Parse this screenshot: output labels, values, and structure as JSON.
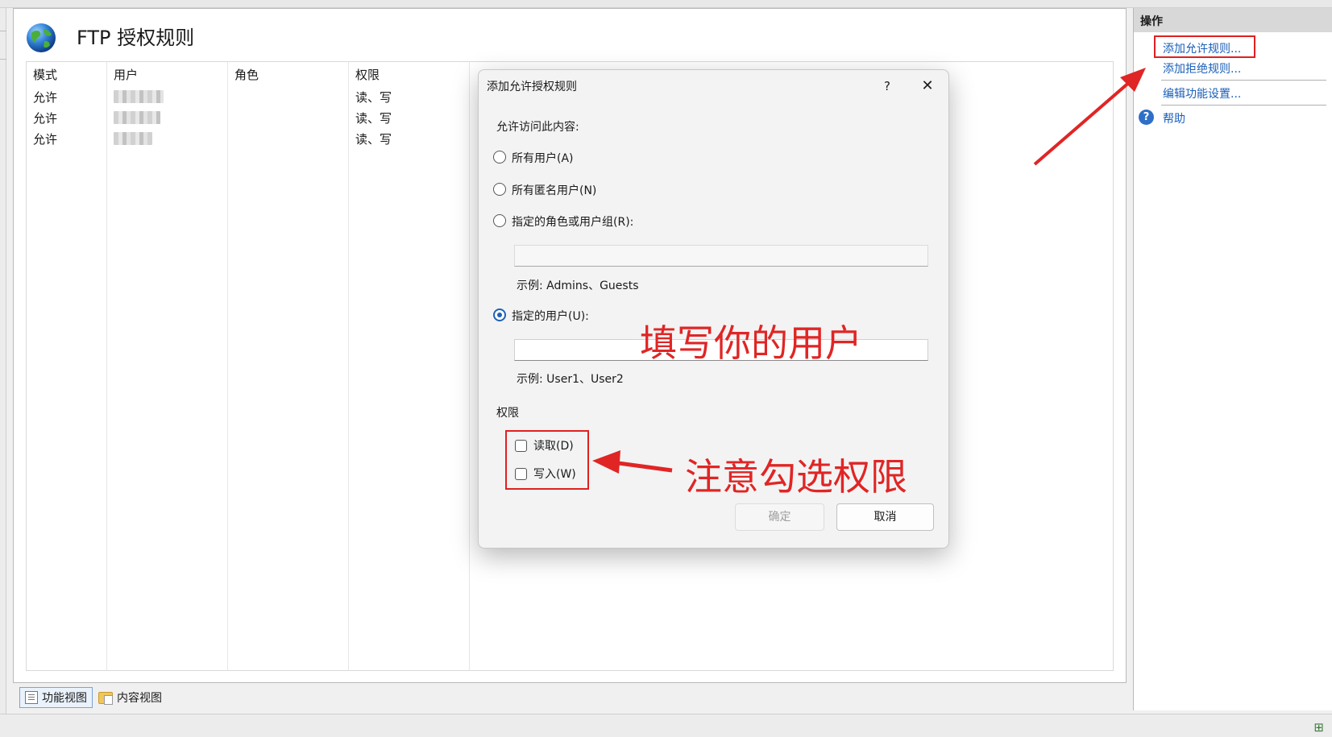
{
  "page": {
    "title": "FTP 授权规则"
  },
  "table": {
    "columns": [
      "模式",
      "用户",
      "角色",
      "权限"
    ],
    "rows": [
      {
        "mode": "允许",
        "role": "",
        "permission": "读、写"
      },
      {
        "mode": "允许",
        "role": "",
        "permission": "读、写"
      },
      {
        "mode": "允许",
        "role": "",
        "permission": "读、写"
      }
    ]
  },
  "views": {
    "features": "功能视图",
    "content": "内容视图"
  },
  "actions": {
    "header": "操作",
    "add_allow": "添加允许规则...",
    "add_deny": "添加拒绝规则...",
    "edit_settings": "编辑功能设置...",
    "help": "帮助"
  },
  "dialog": {
    "title": "添加允许授权规则",
    "help_glyph": "?",
    "close_glyph": "✕",
    "allow_label": "允许访问此内容:",
    "options": {
      "all_users": "所有用户(A)",
      "anonymous": "所有匿名用户(N)",
      "roles": "指定的角色或用户组(R):",
      "users": "指定的用户(U):"
    },
    "selected_option": "users",
    "roles_value": "",
    "roles_example": "示例: Admins、Guests",
    "users_value": "",
    "users_example": "示例: User1、User2",
    "permissions_label": "权限",
    "read": "读取(D)",
    "write": "写入(W)",
    "read_checked": false,
    "write_checked": false,
    "ok": "确定",
    "cancel": "取消"
  },
  "annotations": {
    "fill_user": "填写你的用户",
    "check_permissions": "注意勾选权限",
    "color": "#e02525"
  },
  "colors": {
    "link": "#1b5fb8",
    "accent": "#1e62b5"
  }
}
